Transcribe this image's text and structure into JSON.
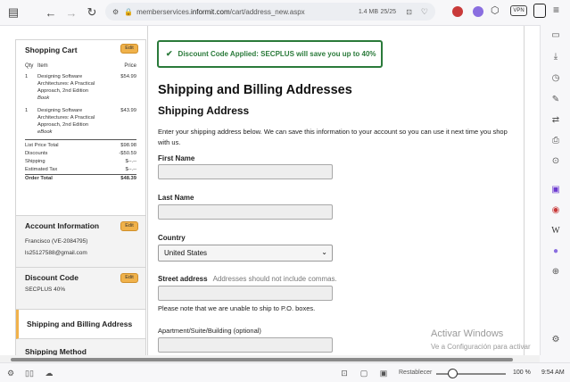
{
  "browser": {
    "url_prefix": "memberservices.",
    "url_host": "informit.com",
    "url_path": "/cart/address_new.aspx",
    "size": "1.4 MB",
    "tabs": "25/25",
    "vpn_label": "VPN"
  },
  "cart": {
    "title": "Shopping Cart",
    "edit_label": "Edit",
    "col_qty": "Qty",
    "col_item": "Item",
    "col_price": "Price",
    "items": [
      {
        "qty": "1",
        "title": "Designing Software Architectures: A Practical Approach, 2nd Edition",
        "format": "Book",
        "price": "$54.99"
      },
      {
        "qty": "1",
        "title": "Designing Software Architectures: A Practical Approach, 2nd Edition",
        "format": "eBook",
        "price": "$43.99"
      }
    ],
    "totals": {
      "list_price_label": "List Price Total",
      "list_price": "$98.98",
      "discounts_label": "Discounts",
      "discounts": "-$50.59",
      "shipping_label": "Shipping",
      "shipping": "$--.--",
      "tax_label": "Estimated Tax",
      "tax": "$--.--",
      "order_total_label": "Order Total",
      "order_total": "$48.39"
    }
  },
  "account": {
    "title": "Account Information",
    "edit_label": "Edit",
    "name": "Francisco (VE-2084795)",
    "email": "ls25127588@gmail.com"
  },
  "discount": {
    "title": "Discount Code",
    "edit_label": "Edit",
    "code": "SECPLUS 40%"
  },
  "steps": {
    "shipping_billing": "Shipping and Billing Address",
    "shipping_method": "Shipping Method"
  },
  "main": {
    "discount_message": "Discount Code Applied: SECPLUS will save you up to 40%",
    "page_title": "Shipping and Billing Addresses",
    "section_title": "Shipping Address",
    "intro": "Enter your shipping address below. We can save this information to your account so you can use it next time you shop with us.",
    "first_name_label": "First Name",
    "last_name_label": "Last Name",
    "country_label": "Country",
    "country_value": "United States",
    "street_label": "Street address",
    "street_hint": "Addresses should not include commas.",
    "po_note": "Please note that we are unable to ship to P.O. boxes.",
    "apt_label": "Apartment/Suite/Building (optional)"
  },
  "watermark": {
    "line1": "Activar Windows",
    "line2": "Ve a Configuración para activar"
  },
  "status": {
    "reset_label": "Restablecer",
    "zoom": "100 %",
    "zoom_level": 1.0,
    "time": "9:54 AM"
  },
  "colors": {
    "accent_orange": "#f0b24b",
    "success_green": "#2a7a3a"
  }
}
